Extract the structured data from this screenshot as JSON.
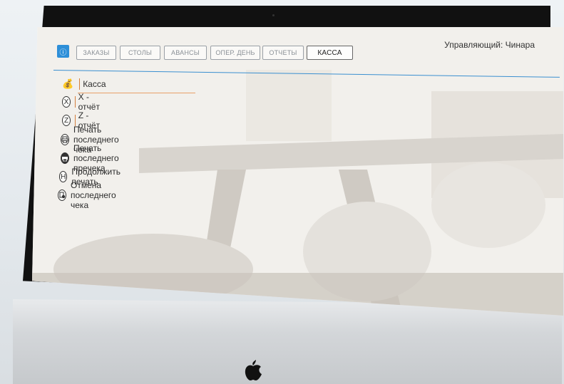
{
  "topbar": {
    "tabs": [
      "ЗАКАЗЫ",
      "СТОЛЫ",
      "АВАНСЫ",
      "ОПЕР. ДЕНЬ",
      "ОТЧЕТЫ",
      "КАССА"
    ],
    "manager": "Управляющий:  Чинара"
  },
  "menu": {
    "items": [
      {
        "label": "Касса",
        "icon": "cash-icon"
      },
      {
        "label": "X - отчёт",
        "icon": "x-report-icon",
        "glyph": "X"
      },
      {
        "label": "Z - отчёт",
        "icon": "z-report-icon",
        "glyph": "Z"
      },
      {
        "label": "Печать последнего чека",
        "icon": "printer-icon"
      },
      {
        "label": "Печать последнего пречека",
        "icon": "printer-filled-icon"
      },
      {
        "label": "Продолжить печать",
        "icon": "continue-print-icon",
        "glyph": "H"
      },
      {
        "label": "Отмена последнего чека",
        "icon": "cancel-receipt-icon"
      }
    ]
  },
  "colors": {
    "accent": "#2e8fd8",
    "separator": "#d47f3d"
  }
}
